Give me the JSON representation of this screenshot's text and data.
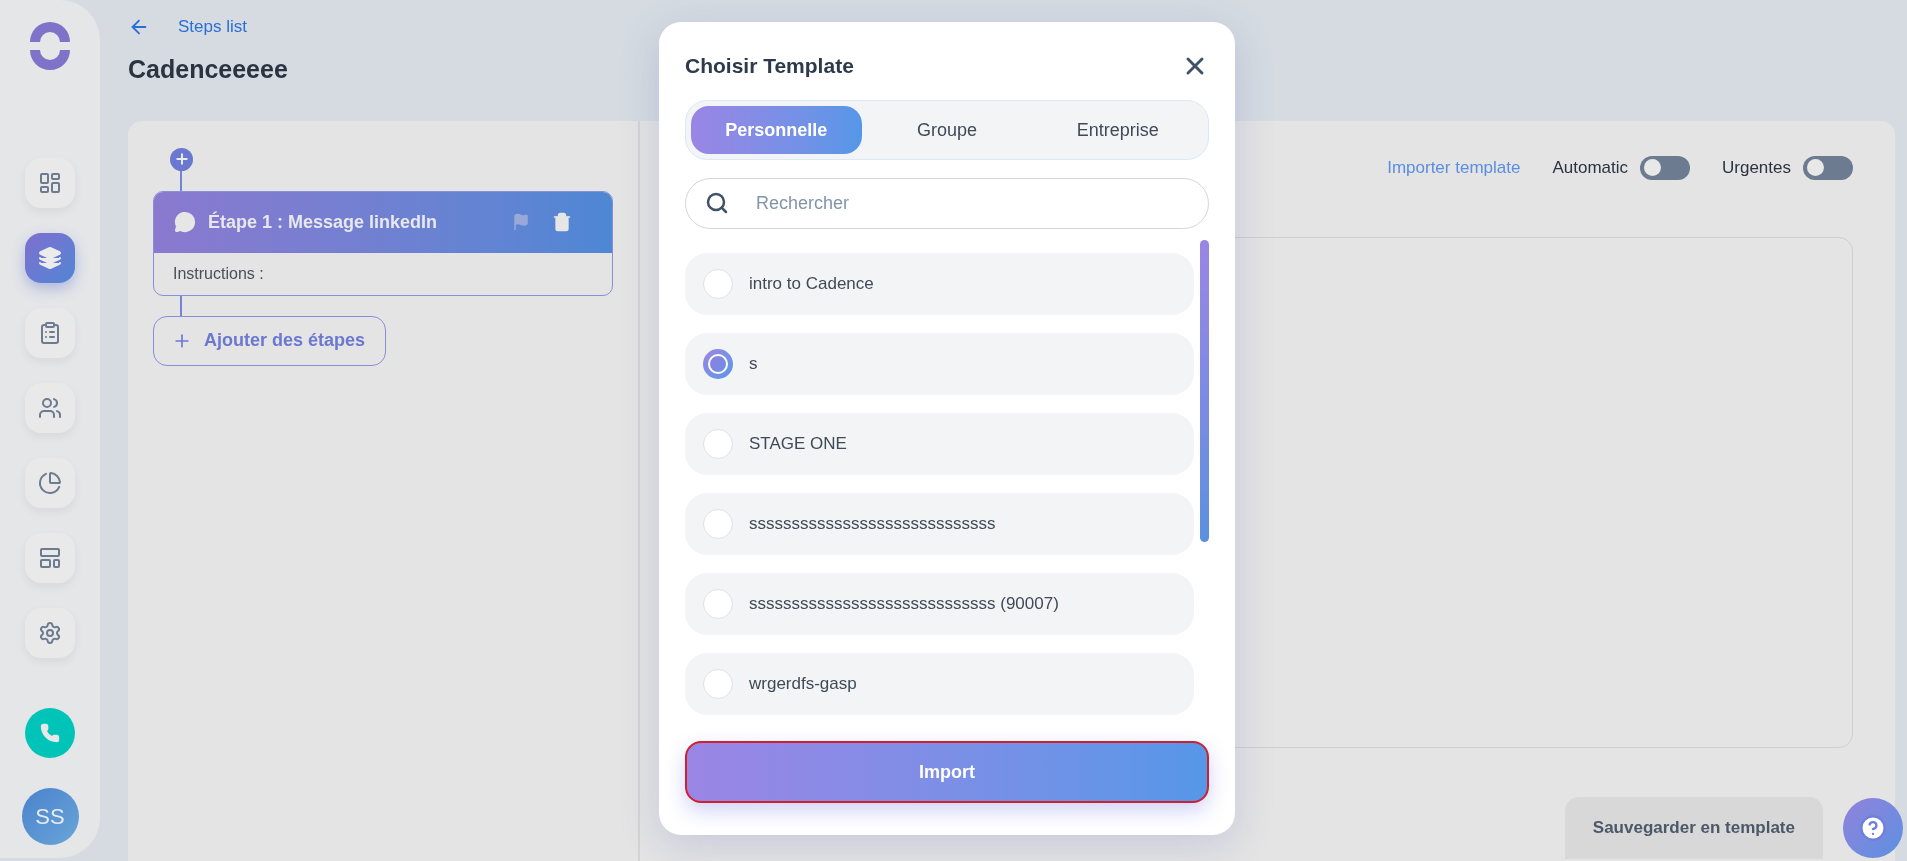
{
  "sidebar": {
    "avatar": "SS",
    "items": [
      {
        "kind": "dashboard",
        "selected": false
      },
      {
        "kind": "cadence",
        "selected": true
      },
      {
        "kind": "tasks",
        "selected": false
      },
      {
        "kind": "contacts",
        "selected": false
      },
      {
        "kind": "reports",
        "selected": false
      },
      {
        "kind": "templates",
        "selected": false
      },
      {
        "kind": "settings",
        "selected": false
      }
    ]
  },
  "header": {
    "back_link": "Steps list",
    "title": "Cadenceeeee"
  },
  "steps": [
    {
      "title": "Étape 1 : Message linkedIn",
      "instructions": "Instructions :"
    }
  ],
  "add_step": "Ajouter des étapes",
  "toolbar": {
    "import_link": "Importer template",
    "toggles": [
      {
        "label": "Automatic",
        "on": false
      },
      {
        "label": "Urgentes",
        "on": false
      }
    ]
  },
  "save_template": "Sauvegarder en template",
  "modal": {
    "title": "Choisir Template",
    "tabs": [
      {
        "label": "Personnelle",
        "selected": true
      },
      {
        "label": "Groupe",
        "selected": false
      },
      {
        "label": "Entreprise",
        "selected": false
      }
    ],
    "search": {
      "placeholder": "Rechercher"
    },
    "templates": [
      {
        "name": "intro to Cadence",
        "selected": false
      },
      {
        "name": "s",
        "selected": true
      },
      {
        "name": "STAGE ONE",
        "selected": false
      },
      {
        "name": "sssssssssssssssssssssssssssss",
        "selected": false
      },
      {
        "name": "sssssssssssssssssssssssssssss (90007)",
        "selected": false
      },
      {
        "name": "wrgerdfs-gasp",
        "selected": false
      }
    ],
    "import_button": "Import"
  }
}
